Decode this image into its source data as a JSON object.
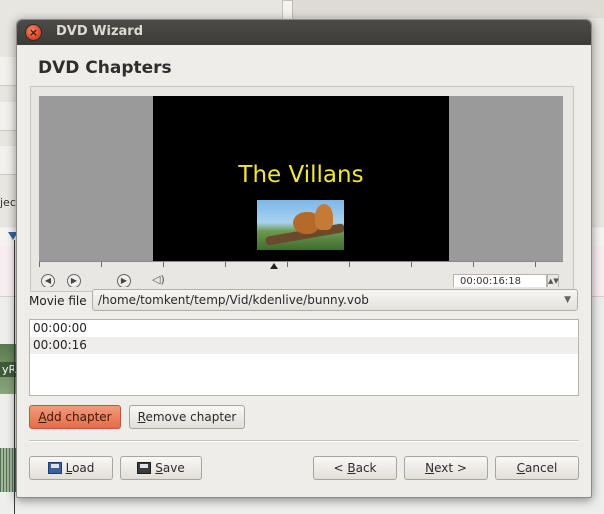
{
  "window": {
    "title": "DVD Wizard"
  },
  "page": {
    "heading": "DVD Chapters"
  },
  "preview": {
    "overlay_title": "The Villans",
    "timecode": "00:00:16:18",
    "controls": [
      "rewind-icon",
      "play-icon",
      "forward-icon",
      "volume-icon"
    ]
  },
  "movie_file": {
    "label": "Movie file",
    "value": "/home/tomkent/temp/Vid/kdenlive/bunny.vob"
  },
  "chapters": [
    "00:00:00",
    "00:00:16"
  ],
  "chapter_buttons": {
    "add": {
      "mnemonic": "A",
      "rest": "dd chapter"
    },
    "remove": {
      "mnemonic": "R",
      "rest": "emove chapter"
    }
  },
  "footer": {
    "load": {
      "mnemonic": "L",
      "rest": "oad"
    },
    "save": {
      "mnemonic": "S",
      "rest": "ave"
    },
    "back": {
      "prefix": "< ",
      "mnemonic": "B",
      "rest": "ack"
    },
    "next": {
      "mnemonic": "N",
      "rest": "ext >"
    },
    "cancel": {
      "mnemonic": "C",
      "rest": "ancel"
    }
  },
  "background": {
    "clip_label": "yR",
    "sidebar_text": "jec"
  },
  "colors": {
    "title_yellow": "#f1e63a",
    "accent_button": "#e56c47",
    "titlebar": "#3c3b37"
  }
}
